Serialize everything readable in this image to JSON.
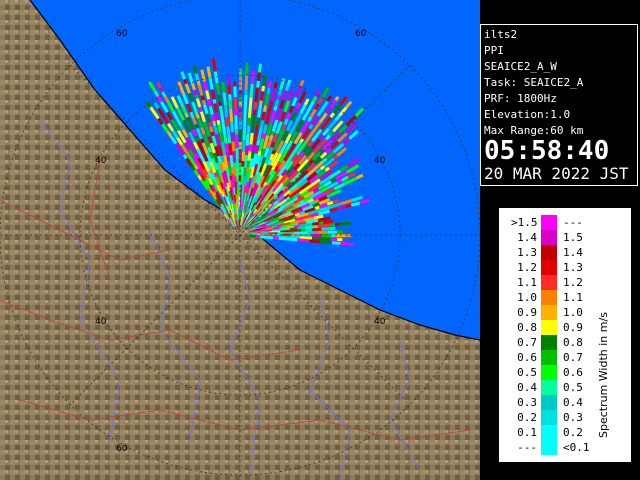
{
  "info": {
    "site": "ilts2",
    "mode": "PPI",
    "scan": "SEAICE2_A_W",
    "task": "Task: SEAICE2_A",
    "prf": "PRF: 1800Hz",
    "elevation": "Elevation:1.0",
    "max_range": "Max Range:60 km",
    "time": "05:58:40",
    "date": "20 MAR 2022 JST"
  },
  "legend": {
    "title": "Spectrum Width in m/s",
    "rows": [
      {
        "lo": ">1.5",
        "hi": "---",
        "color": "#ff00ff"
      },
      {
        "lo": "1.4",
        "hi": "1.5",
        "color": "#d800c8"
      },
      {
        "lo": "1.3",
        "hi": "1.4",
        "color": "#c00000"
      },
      {
        "lo": "1.2",
        "hi": "1.3",
        "color": "#e00000"
      },
      {
        "lo": "1.1",
        "hi": "1.2",
        "color": "#ff2a2a"
      },
      {
        "lo": "1.0",
        "hi": "1.1",
        "color": "#ff8000"
      },
      {
        "lo": "0.9",
        "hi": "1.0",
        "color": "#ffb000"
      },
      {
        "lo": "0.8",
        "hi": "0.9",
        "color": "#ffff00"
      },
      {
        "lo": "0.7",
        "hi": "0.8",
        "color": "#008000"
      },
      {
        "lo": "0.6",
        "hi": "0.7",
        "color": "#00c000"
      },
      {
        "lo": "0.5",
        "hi": "0.6",
        "color": "#00ff00"
      },
      {
        "lo": "0.4",
        "hi": "0.5",
        "color": "#00ffa0"
      },
      {
        "lo": "0.3",
        "hi": "0.4",
        "color": "#00c8c8"
      },
      {
        "lo": "0.2",
        "hi": "0.3",
        "color": "#00e0e0"
      },
      {
        "lo": "0.1",
        "hi": "0.2",
        "color": "#00ffff"
      },
      {
        "lo": "---",
        "hi": "<0.1",
        "color": "#00ffff"
      }
    ]
  },
  "map": {
    "range_labels": [
      "60",
      "60",
      "40",
      "40",
      "40",
      "40",
      "60"
    ],
    "colors": {
      "sea": "#0066ff",
      "land": "#8b7a58",
      "range_ring": "#333333"
    }
  }
}
